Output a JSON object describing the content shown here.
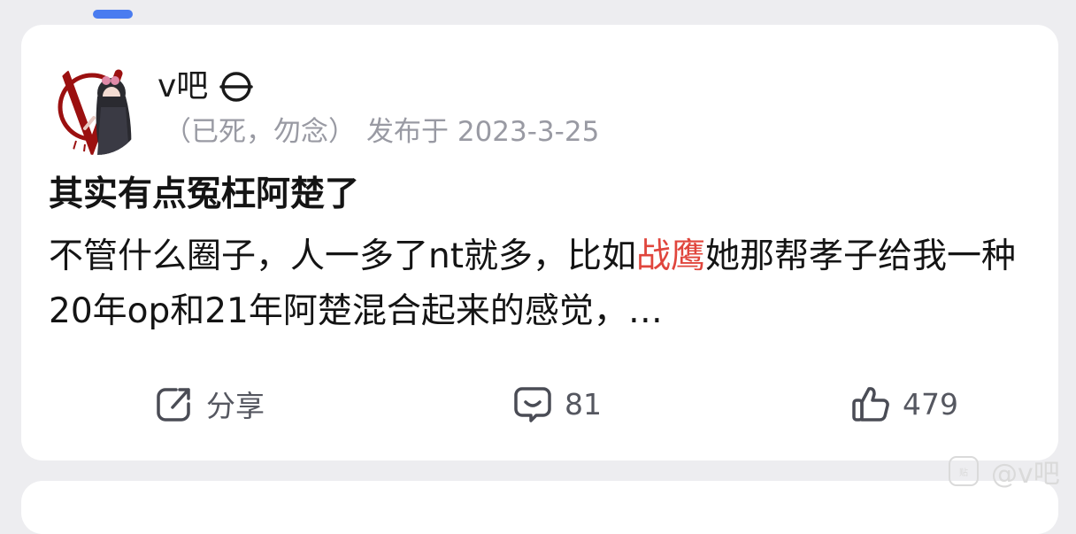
{
  "post": {
    "author": {
      "name": "v吧",
      "meta_prefix": "（已死，勿念）",
      "published_label": "发布于 2023-3-25"
    },
    "title": "其实有点冤枉阿楚了",
    "body_part1": "不管什么圈子，人一多了nt就多，比如",
    "body_highlight": "战鹰",
    "body_part2": "她那帮孝子给我一种20年op和21年阿楚混合起来的感觉，…",
    "highlight_color": "#e0453c"
  },
  "actions": {
    "share_label": "分享",
    "comment_count": "81",
    "like_count": "479"
  },
  "watermark": {
    "text": "@v吧"
  },
  "colors": {
    "accent": "#4a7cf0",
    "background": "#ededf0",
    "card": "#ffffff"
  }
}
